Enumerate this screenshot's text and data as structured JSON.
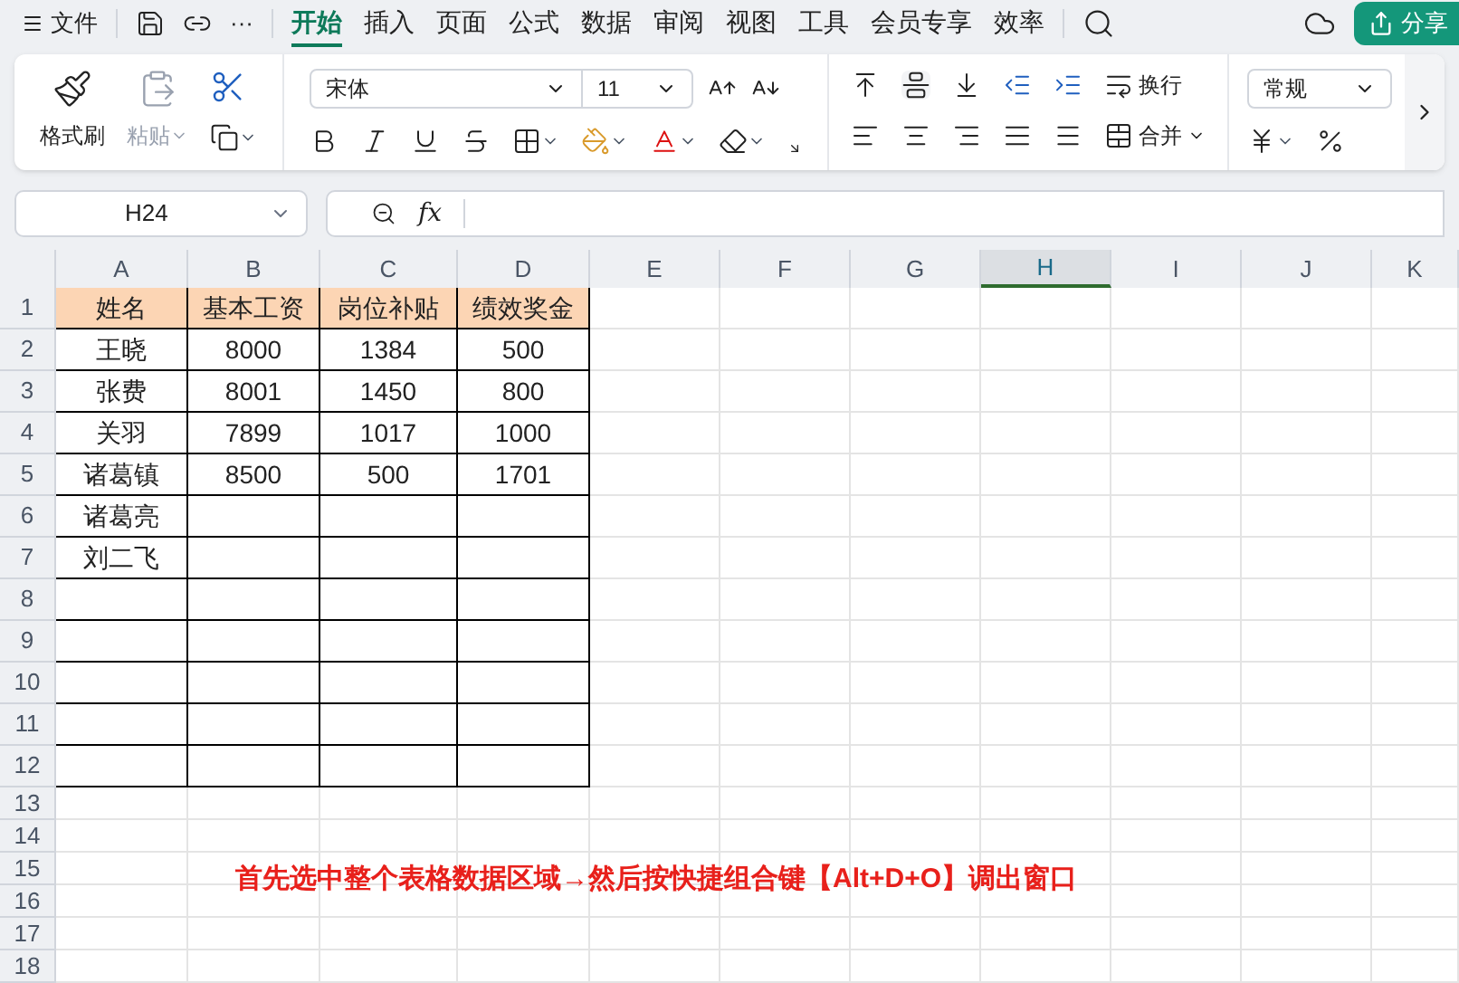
{
  "menu_bar": {
    "file": "文件",
    "more": "···",
    "tabs": [
      {
        "label": "开始",
        "selected": true
      },
      {
        "label": "插入",
        "selected": false
      },
      {
        "label": "页面",
        "selected": false
      },
      {
        "label": "公式",
        "selected": false
      },
      {
        "label": "数据",
        "selected": false
      },
      {
        "label": "审阅",
        "selected": false
      },
      {
        "label": "视图",
        "selected": false
      },
      {
        "label": "工具",
        "selected": false
      },
      {
        "label": "会员专享",
        "selected": false
      },
      {
        "label": "效率",
        "selected": false
      }
    ],
    "share": "分享"
  },
  "ribbon": {
    "format_painter": "格式刷",
    "paste": {
      "label": "粘贴",
      "disabled": true
    },
    "font": "宋体",
    "font_size": "11",
    "wrap": "换行",
    "merge": "合并",
    "number_format": "常规"
  },
  "formula_bar": {
    "name_box": "H24",
    "fx": "fx"
  },
  "sheet": {
    "columns": [
      {
        "label": "A",
        "selected": false
      },
      {
        "label": "B",
        "selected": false
      },
      {
        "label": "C",
        "selected": false
      },
      {
        "label": "D",
        "selected": false
      },
      {
        "label": "E",
        "selected": false
      },
      {
        "label": "F",
        "selected": false
      },
      {
        "label": "G",
        "selected": false
      },
      {
        "label": "H",
        "selected": true
      },
      {
        "label": "I",
        "selected": false
      },
      {
        "label": "J",
        "selected": false
      },
      {
        "label": "K",
        "selected": false
      }
    ],
    "table": {
      "header": {
        "label": "1",
        "cells": [
          "姓名",
          "基本工资",
          "岗位补贴",
          "绩效奖金"
        ]
      },
      "rows": [
        {
          "label": "2",
          "cells": [
            "王晓",
            "8000",
            "1384",
            "500"
          ]
        },
        {
          "label": "3",
          "cells": [
            "张费",
            "8001",
            "1450",
            "800"
          ]
        },
        {
          "label": "4",
          "cells": [
            "关羽",
            "7899",
            "1017",
            "1000"
          ]
        },
        {
          "label": "5",
          "cells": [
            "诸葛镇",
            "8500",
            "500",
            "1701"
          ]
        },
        {
          "label": "6",
          "cells": [
            "诸葛亮"
          ]
        },
        {
          "label": "7",
          "cells": [
            "刘二飞"
          ]
        },
        {
          "label": "8"
        },
        {
          "label": "9"
        },
        {
          "label": "10"
        },
        {
          "label": "11"
        },
        {
          "label": "12"
        }
      ]
    },
    "empty_rows": [
      "13",
      "14",
      "15",
      "16",
      "17",
      "18"
    ],
    "annotation": "首先选中整个表格数据区域→然后按快捷组合键【Alt+D+O】调出窗口"
  }
}
